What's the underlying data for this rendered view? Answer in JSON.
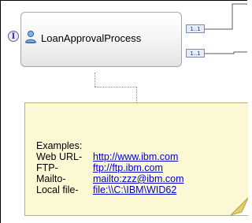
{
  "component": {
    "interface_glyph": "I",
    "title": "LoanApprovalProcess",
    "icon": "process-person-icon",
    "references": [
      {
        "label": "1..1"
      },
      {
        "label": "1..1"
      }
    ]
  },
  "note": {
    "heading": "Examples:",
    "rows": [
      {
        "label": "Web URL-",
        "link": "http://www.ibm.com"
      },
      {
        "label": "FTP-",
        "link": "ftp://ftp.ibm.com"
      },
      {
        "label": "Mailto-",
        "link": "mailto:zzz@ibm.com"
      },
      {
        "label": "Local file-",
        "link": "file:\\\\C:\\IBM\\WID62"
      }
    ]
  },
  "colors": {
    "note_background": "#fdf9d5",
    "link": "#0000cc",
    "component_border": "#a7a7a7",
    "interface_accent": "#6b55a7"
  }
}
